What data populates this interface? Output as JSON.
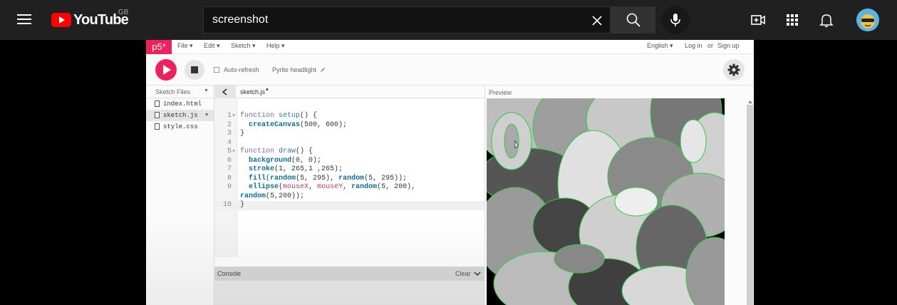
{
  "youtube": {
    "logo_text": "YouTube",
    "region": "GB",
    "search_value": "screenshot"
  },
  "p5": {
    "logo": "p5*",
    "menus": [
      "File ▾",
      "Edit ▾",
      "Sketch ▾",
      "Help ▾"
    ],
    "language": "English ▾",
    "login": "Log in",
    "or": "or",
    "signup": "Sign up",
    "auto_refresh": "Auto-refresh",
    "sketch_name": "Pyrite headlight",
    "sketch_files_label": "Sketch Files",
    "files": [
      {
        "name": "index.html",
        "active": false
      },
      {
        "name": "sketch.js",
        "active": true
      },
      {
        "name": "style.css",
        "active": false
      }
    ],
    "tab_name": "sketch.js",
    "tab_unsaved": "•",
    "preview_label": "Preview",
    "console_label": "Console",
    "clear_label": "Clear",
    "code_lines": [
      {
        "n": "1",
        "fold": true,
        "text": "function setup() {"
      },
      {
        "n": "2",
        "fold": false,
        "text": "  createCanvas(500, 600);"
      },
      {
        "n": "3",
        "fold": false,
        "text": "}"
      },
      {
        "n": "4",
        "fold": false,
        "text": ""
      },
      {
        "n": "5",
        "fold": true,
        "text": "function draw() {"
      },
      {
        "n": "6",
        "fold": false,
        "text": "  background(0, 0);"
      },
      {
        "n": "7",
        "fold": false,
        "text": "  stroke(1, 265,1 ,265);"
      },
      {
        "n": "8",
        "fold": false,
        "text": "  fill(random(5, 295), random(5, 295));"
      },
      {
        "n": "9",
        "fold": false,
        "text": "  ellipse(mouseX, mouseY, random(5, 200),"
      },
      {
        "n": "",
        "fold": false,
        "text": "random(5,200));"
      },
      {
        "n": "10",
        "fold": false,
        "text": "}"
      }
    ]
  }
}
